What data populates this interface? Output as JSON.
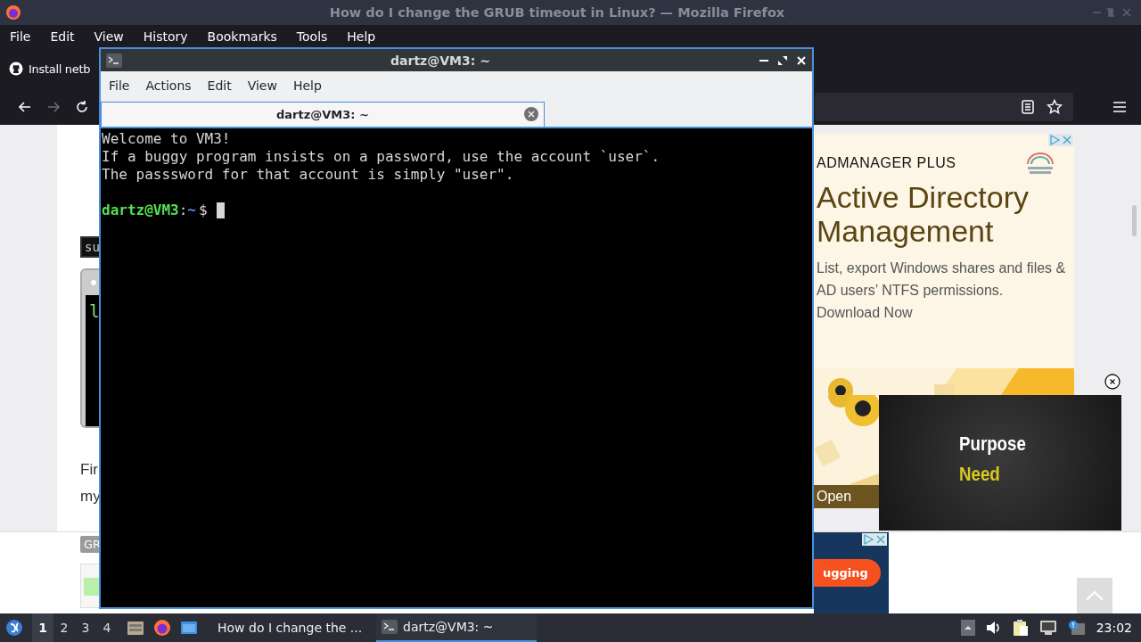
{
  "browser": {
    "title": "How do I change the GRUB timeout in Linux? — Mozilla Firefox",
    "menu": [
      {
        "label": "File"
      },
      {
        "label": "Edit"
      },
      {
        "label": "View"
      },
      {
        "label": "History"
      },
      {
        "label": "Bookmarks"
      },
      {
        "label": "Tools"
      },
      {
        "label": "Help"
      }
    ],
    "tab": {
      "label": "Install netb"
    },
    "nav": {
      "back_disabled": false,
      "forward_disabled": true
    }
  },
  "page": {
    "code_label": "su",
    "code_line": "l",
    "paragraph_lines": [
      "Fir",
      "my"
    ],
    "bottom_badge": "GR",
    "ad": {
      "brand": "ADMANAGER PLUS",
      "headline": "Active Directory Management",
      "body": "List, export Windows shares and files & AD users’ NTFS permissions.",
      "cta": "Download Now",
      "overlay_label": "Open"
    },
    "video": {
      "line_1": "Purpose",
      "line_2": "Need"
    },
    "bottom_ad": {
      "button": "ugging"
    }
  },
  "terminal": {
    "title": "dartz@VM3: ~",
    "menu": [
      {
        "label": "File"
      },
      {
        "label": "Actions"
      },
      {
        "label": "Edit"
      },
      {
        "label": "View"
      },
      {
        "label": "Help"
      }
    ],
    "tabs": [
      {
        "label": "dartz@VM3: ~",
        "selected": true
      }
    ],
    "lines": [
      "Welcome to VM3!",
      "If a buggy program insists on a password, use the account `user`.",
      "The passsword for that account is simply \"user\"."
    ],
    "prompt": {
      "user_host": "dartz@VM3",
      "sep": ":",
      "path": "~",
      "symbol": "$"
    }
  },
  "taskbar": {
    "workspaces": [
      {
        "label": "1",
        "selected": true
      },
      {
        "label": "2",
        "selected": false
      },
      {
        "label": "3",
        "selected": false
      },
      {
        "label": "4",
        "selected": false
      }
    ],
    "tasks": [
      {
        "kind": "browser",
        "label": "How do I change the ...",
        "selected": false
      },
      {
        "kind": "terminal",
        "label": "dartz@VM3: ~",
        "selected": true
      }
    ],
    "clock": "23:02"
  }
}
